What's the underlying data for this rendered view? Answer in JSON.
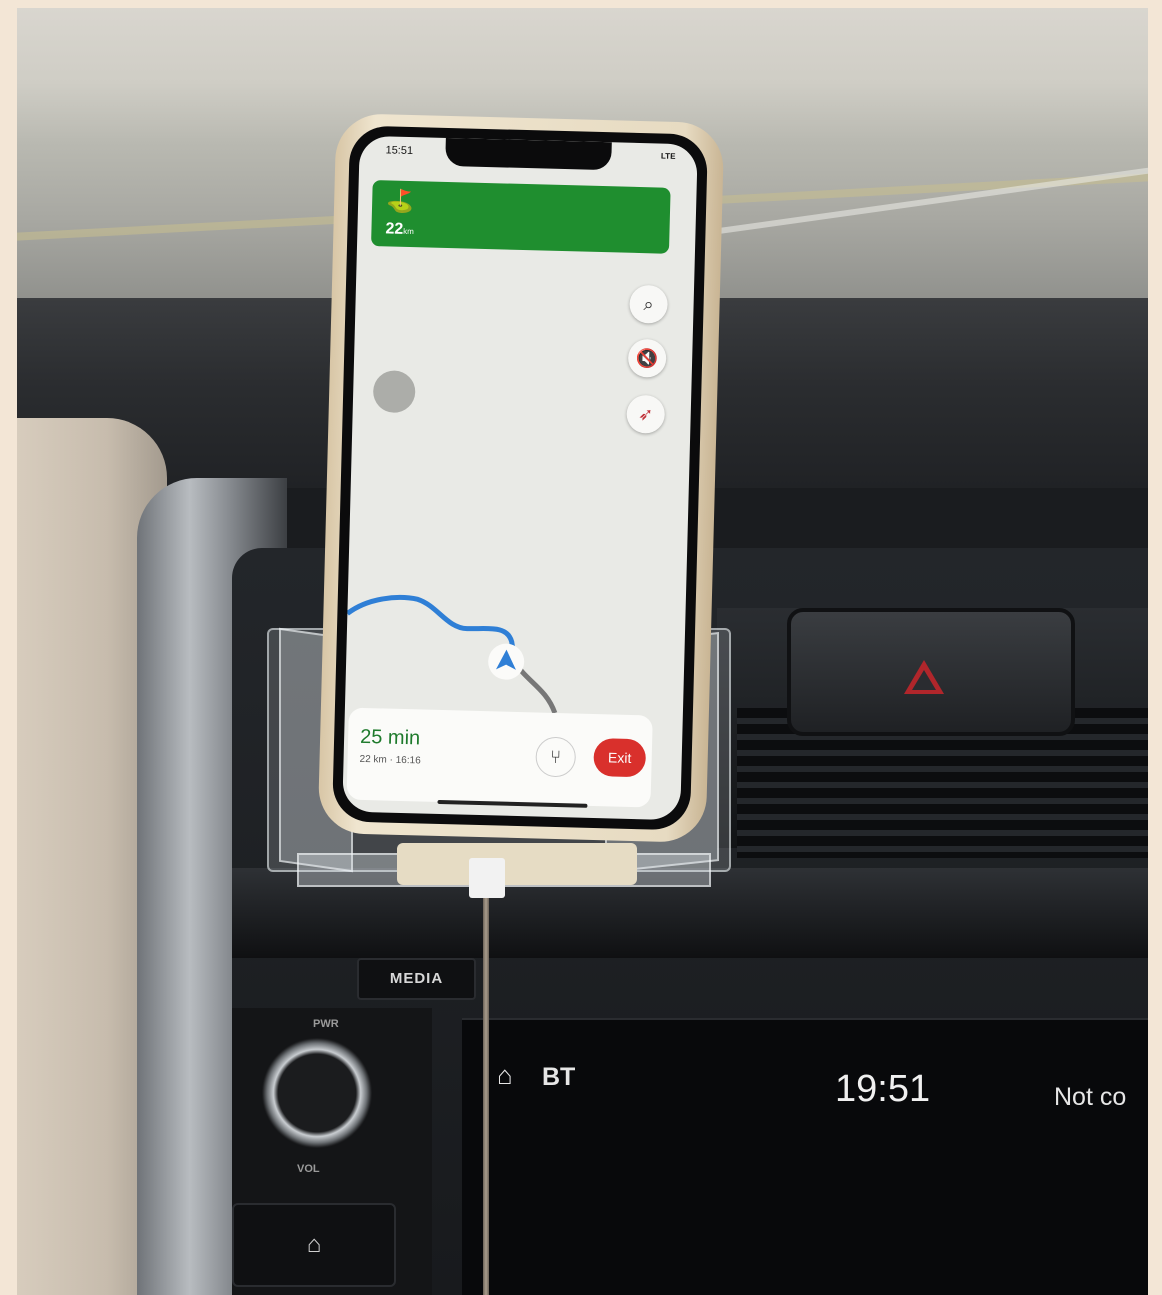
{
  "phone": {
    "status_time": "15:51",
    "status_network": "LTE",
    "nav_distance_value": "22",
    "nav_distance_unit": "km",
    "eta_duration": "25 min",
    "eta_details": "22 km · 16:16",
    "exit_label": "Exit",
    "icons": [
      "route-icon",
      "search-icon",
      "mute-icon",
      "compass-icon",
      "alt-route-icon",
      "navigation-arrow-icon"
    ],
    "colors": {
      "nav_banner": "#1f8e2f",
      "eta_text": "#1e7a2c",
      "exit_button": "#d9302c",
      "route": "#2f7fd6"
    }
  },
  "dashboard": {
    "media_label": "MEDIA",
    "power_label": "PWR",
    "volume_label": "VOL",
    "screen_source": "BT",
    "screen_time": "19:51",
    "screen_status": "Not co"
  }
}
